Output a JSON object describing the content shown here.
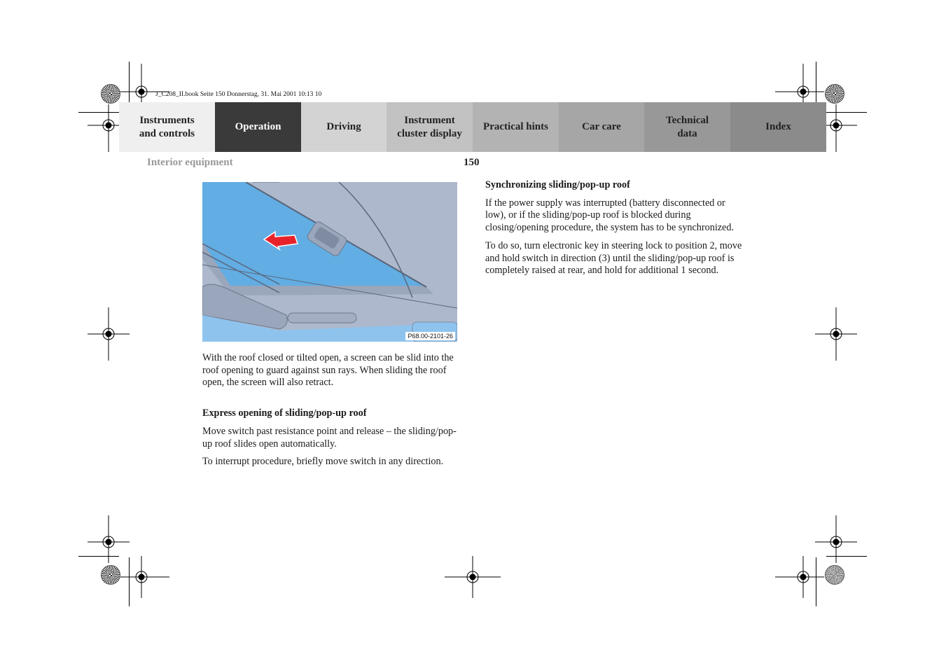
{
  "slug": "J_C208_II.book  Seite 150  Donnerstag, 31. Mai 2001  10:13 10",
  "tabs": [
    {
      "label": "Instruments\nand controls",
      "bg": "#efefef",
      "fg": "#222222"
    },
    {
      "label": "Operation",
      "bg": "#3a3a3a",
      "fg": "#ffffff"
    },
    {
      "label": "Driving",
      "bg": "#d3d3d3",
      "fg": "#222222"
    },
    {
      "label": "Instrument\ncluster display",
      "bg": "#c2c2c2",
      "fg": "#222222"
    },
    {
      "label": "Practical hints",
      "bg": "#b3b3b3",
      "fg": "#222222"
    },
    {
      "label": "Car care",
      "bg": "#a6a6a6",
      "fg": "#222222"
    },
    {
      "label": "Technical\ndata",
      "bg": "#989898",
      "fg": "#222222"
    },
    {
      "label": "Index",
      "bg": "#8b8b8b",
      "fg": "#222222"
    }
  ],
  "header": {
    "section": "Interior equipment",
    "page_number": "150"
  },
  "figure": {
    "id": "P68.00-2101-26",
    "description": "Sliding sunroof interior view with red arrow indicating sun screen direction"
  },
  "left_column": {
    "intro": "With the roof closed or tilted open, a screen can be slid into the roof opening to guard against sun rays. When sliding the roof open, the screen will also retract.",
    "express_heading": "Express opening of sliding/pop-up roof",
    "express_p1": "Move switch past resistance point and release – the sliding/pop-up roof slides open automatically.",
    "express_p2": "To interrupt procedure, briefly move switch in any direction."
  },
  "right_column": {
    "sync_heading": "Synchronizing sliding/pop-up roof",
    "sync_p1": "If the power supply was interrupted (battery disconnected or low), or if the sliding/pop-up roof is blocked during closing/opening procedure, the system has to be synchronized.",
    "sync_p2": "To do so, turn electronic key in steering lock to position 2, move and hold switch in direction (3) until the sliding/pop-up roof is completely raised at rear, and hold for additional 1 second."
  }
}
